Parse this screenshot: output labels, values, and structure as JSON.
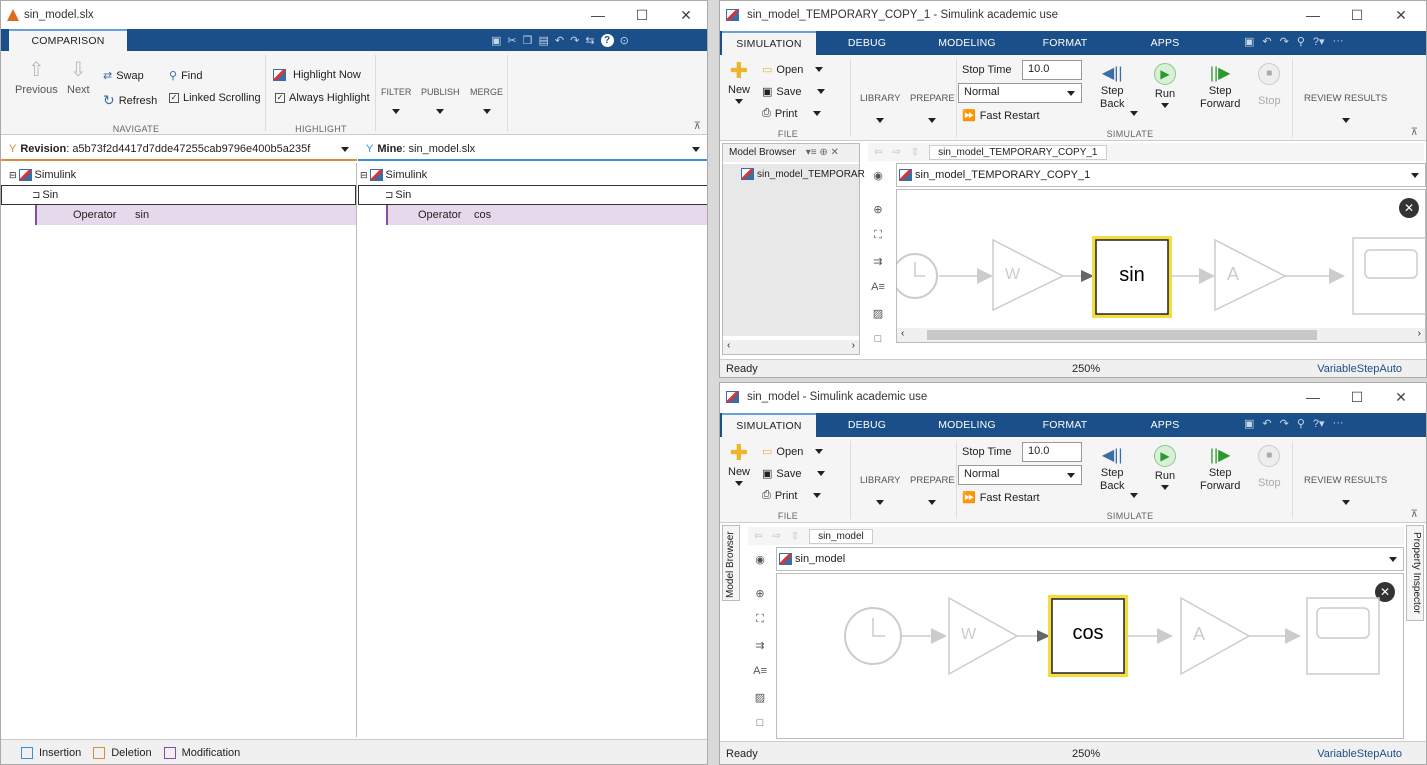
{
  "comparison": {
    "title": "sin_model.slx",
    "tab": "COMPARISON",
    "navigate": {
      "previous": "Previous",
      "next": "Next",
      "swap": "Swap",
      "refresh": "Refresh",
      "find": "Find",
      "linked_scrolling": "Linked Scrolling",
      "section": "NAVIGATE"
    },
    "highlight": {
      "now": "Highlight Now",
      "always": "Always Highlight",
      "section": "HIGHLIGHT"
    },
    "filter": "FILTER",
    "publish": "PUBLISH",
    "merge": "MERGE",
    "left_header": {
      "label": "Revision",
      "value": " : a5b73f2d4417d7dde47255cab9796e400b5a235f"
    },
    "right_header": {
      "label": "Mine",
      "value": " : sin_model.slx"
    },
    "left_tree": {
      "root": "Simulink",
      "block": "Sin",
      "param": "Operator",
      "value": "sin"
    },
    "right_tree": {
      "root": "Simulink",
      "block": "Sin",
      "param": "Operator",
      "value": "cos"
    },
    "legend": {
      "insertion": "Insertion",
      "deletion": "Deletion",
      "modification": "Modification"
    },
    "colors": {
      "insertion": "#3a8fd6",
      "deletion": "#d1913c",
      "modification": "#8b4d9e"
    }
  },
  "top_sim": {
    "title": "sin_model_TEMPORARY_COPY_1 - Simulink academic use",
    "tabs": [
      "SIMULATION",
      "DEBUG",
      "MODELING",
      "FORMAT",
      "APPS"
    ],
    "new": "New",
    "open": "Open",
    "save": "Save",
    "print": "Print",
    "file_section": "FILE",
    "library": "LIBRARY",
    "prepare": "PREPARE",
    "stop_time_label": "Stop Time",
    "stop_time": "10.0",
    "mode": "Normal",
    "fast_restart": "Fast Restart",
    "step_back": "Step\nBack",
    "run": "Run",
    "step_forward": "Step\nForward",
    "stop": "Stop",
    "simulate_section": "SIMULATE",
    "review": "REVIEW RESULTS",
    "model_browser": "Model Browser",
    "browser_item": "sin_model_TEMPORAR",
    "breadcrumb": "sin_model_TEMPORARY_COPY_1",
    "address": "sin_model_TEMPORARY_COPY_1",
    "gain_label": "W",
    "func_label": "sin",
    "amp_label": "A",
    "status": "Ready",
    "zoom": "250%",
    "solver": "VariableStepAuto"
  },
  "bottom_sim": {
    "title": "sin_model - Simulink academic use",
    "tabs": [
      "SIMULATION",
      "DEBUG",
      "MODELING",
      "FORMAT",
      "APPS"
    ],
    "new": "New",
    "open": "Open",
    "save": "Save",
    "print": "Print",
    "file_section": "FILE",
    "library": "LIBRARY",
    "prepare": "PREPARE",
    "stop_time_label": "Stop Time",
    "stop_time": "10.0",
    "mode": "Normal",
    "fast_restart": "Fast Restart",
    "step_back": "Step\nBack",
    "run": "Run",
    "step_forward": "Step\nForward",
    "stop": "Stop",
    "simulate_section": "SIMULATE",
    "review": "REVIEW RESULTS",
    "model_browser": "Model Browser",
    "property_inspector": "Property Inspector",
    "breadcrumb": "sin_model",
    "address": "sin_model",
    "gain_label": "W",
    "func_label": "cos",
    "amp_label": "A",
    "status": "Ready",
    "zoom": "250%",
    "solver": "VariableStepAuto"
  }
}
